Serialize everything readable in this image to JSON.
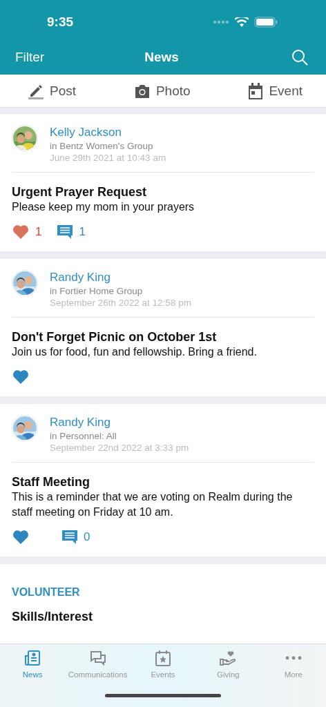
{
  "status_bar": {
    "time": "9:35"
  },
  "nav": {
    "left": "Filter",
    "title": "News"
  },
  "actions": [
    {
      "kind": "post",
      "label": "Post"
    },
    {
      "label": "Photo"
    },
    {
      "kind": "event",
      "label": "Event"
    }
  ],
  "posts": [
    {
      "author": "Kelly Jackson",
      "group": "in Bentz Women's Group",
      "date": "June 29th 2021 at 10:43 am",
      "title": "Urgent Prayer Request",
      "body": "Please keep my mom in your prayers",
      "liked": true,
      "likes": "1",
      "comments": "1"
    },
    {
      "author": "Randy King",
      "group": "in Fortier Home Group",
      "date": "September 26th 2022 at 12:58 pm",
      "title": "Don't Forget Picnic on October 1st",
      "body": "Join us for food, fun and fellowship.  Bring a friend.",
      "liked": false
    },
    {
      "author": "Randy King",
      "group": "in Personnel: All",
      "date": "September 22nd 2022 at 3:33 pm",
      "title": "Staff Meeting",
      "body": "This is a reminder that we are voting on Realm during the staff meeting on Friday at 10 am.",
      "liked": false,
      "comments": "0"
    }
  ],
  "volunteer": {
    "heading": "VOLUNTEER",
    "item": "Skills/Interest"
  },
  "tab_bar": [
    {
      "kind": "news",
      "label": "News",
      "selected": true
    },
    {
      "kind": "communications",
      "label": "Communications",
      "selected": false
    },
    {
      "kind": "events",
      "label": "Events",
      "selected": false
    },
    {
      "kind": "giving",
      "label": "Giving",
      "selected": false
    },
    {
      "kind": "more",
      "label": "More",
      "selected": false
    }
  ]
}
